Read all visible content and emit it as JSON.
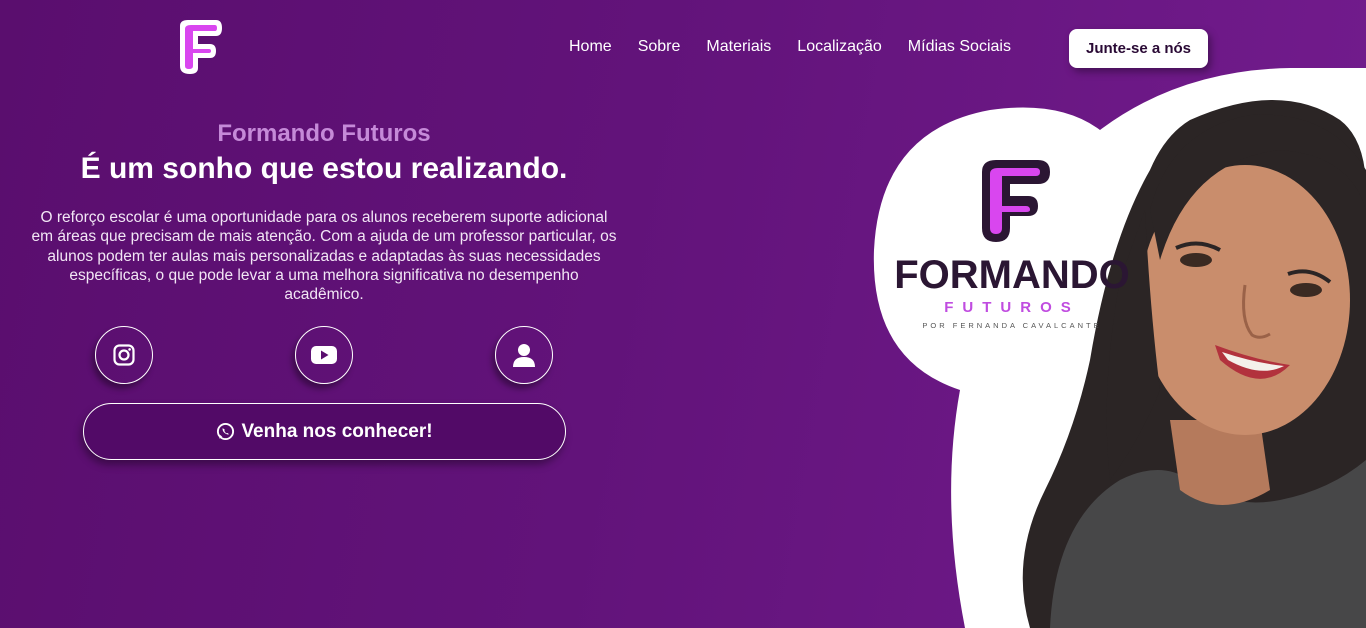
{
  "header": {
    "nav": [
      "Home",
      "Sobre",
      "Materiais",
      "Localização",
      "Mídias Sociais"
    ],
    "join_label": "Junte-se a nós"
  },
  "hero": {
    "subtitle": "Formando Futuros",
    "title": "É um sonho que estou realizando.",
    "description": "O reforço escolar é uma oportunidade para os alunos receberem suporte adicional em áreas que precisam de mais atenção. Com a ajuda de um professor particular, os alunos podem ter aulas mais personalizadas e adaptadas às suas necessidades específicas, o que pode levar a uma melhora significativa no desempenho acadêmico.",
    "cta_label": "Venha nos conhecer!"
  },
  "social_icons": [
    "instagram-icon",
    "youtube-icon",
    "user-icon"
  ],
  "photo_logo": {
    "brand": "FORMANDO",
    "sub": "FUTUROS",
    "by": "POR FERNANDA CAVALCANTE"
  },
  "colors": {
    "background": "#62137a",
    "accent": "#c58ad8",
    "logo_pink": "#d946ef",
    "cta_bg": "#520a67"
  }
}
